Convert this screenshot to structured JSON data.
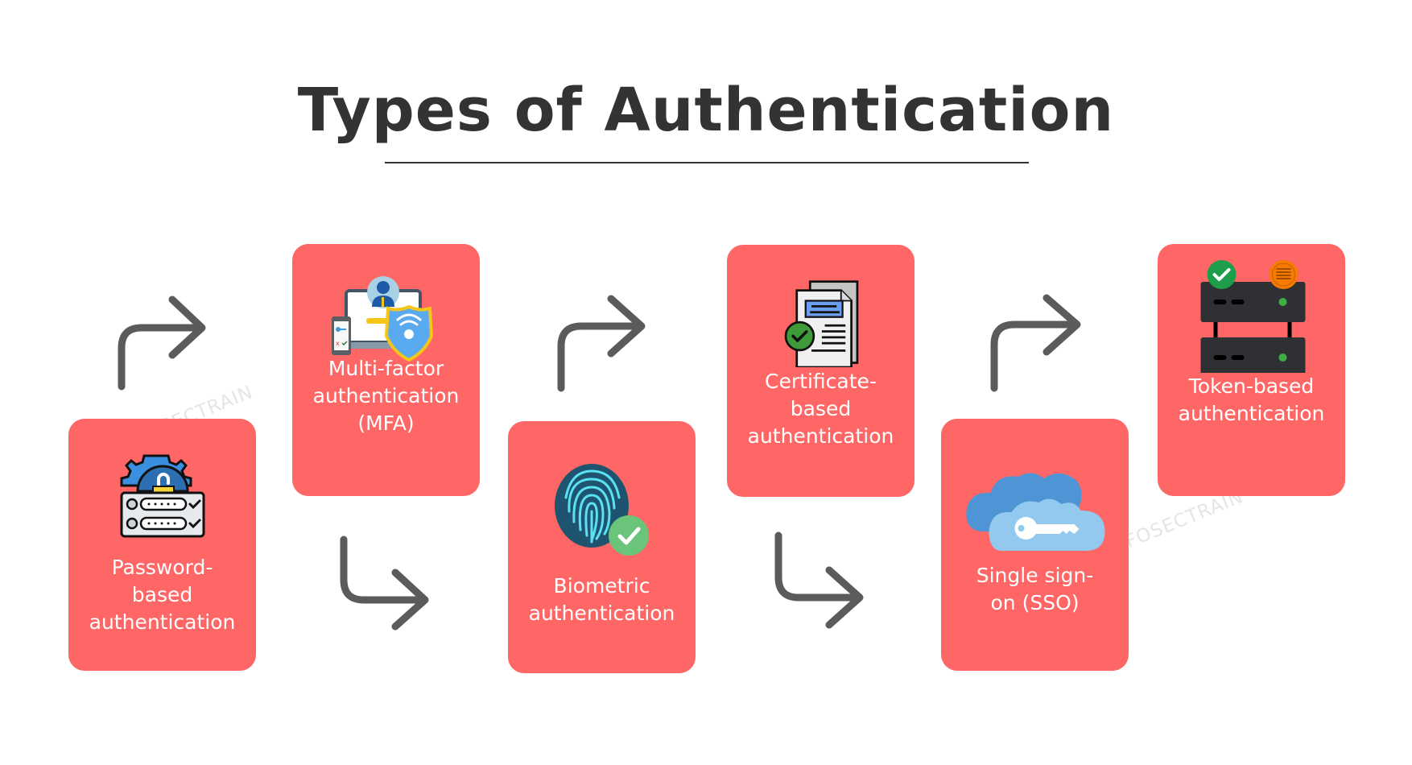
{
  "title": "Types of Authentication",
  "watermark": "INFOSECTRAIN",
  "colors": {
    "card": "#ff6666",
    "title": "#333333",
    "arrow": "#5b5b5b",
    "label": "#ffffff"
  },
  "steps": [
    {
      "order": 1,
      "row": "bottom",
      "icon": "password-lock-icon",
      "label_lines": [
        "Password-",
        "based",
        "authentication"
      ]
    },
    {
      "order": 2,
      "row": "top",
      "icon": "mfa-icon",
      "label_lines": [
        "Multi-factor",
        "authentication",
        "(MFA)"
      ]
    },
    {
      "order": 3,
      "row": "bottom",
      "icon": "fingerprint-icon",
      "label_lines": [
        "Biometric",
        "authentication"
      ]
    },
    {
      "order": 4,
      "row": "top",
      "icon": "certificate-icon",
      "label_lines": [
        "Certificate-",
        "based",
        "authentication"
      ]
    },
    {
      "order": 5,
      "row": "bottom",
      "icon": "cloud-key-icon",
      "label_lines": [
        "Single sign-",
        "on (SSO)"
      ]
    },
    {
      "order": 6,
      "row": "top",
      "icon": "token-server-icon",
      "label_lines": [
        "Token-based",
        "authentication"
      ]
    }
  ],
  "connectors": [
    {
      "from": 1,
      "to": 2,
      "direction": "up-right"
    },
    {
      "from": 2,
      "to": 3,
      "direction": "down-right"
    },
    {
      "from": 3,
      "to": 4,
      "direction": "up-right"
    },
    {
      "from": 4,
      "to": 5,
      "direction": "down-right"
    },
    {
      "from": 5,
      "to": 6,
      "direction": "up-right"
    }
  ]
}
